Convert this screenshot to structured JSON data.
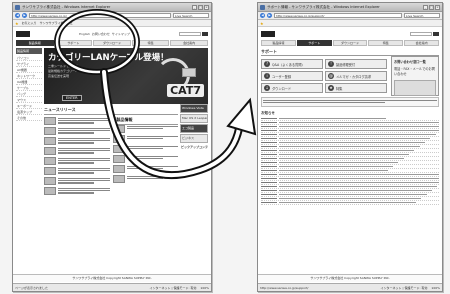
{
  "left_window": {
    "title": "サンワサプライ株式会社 - Windows Internet Explorer",
    "address": "http://www.sanwa.co.jp/",
    "search_placeholder": "Live Search",
    "favorites": [
      "お気に入り",
      "サンワサプライ株式会社"
    ],
    "header_links": [
      "English",
      "お問い合わせ",
      "サイトマップ"
    ],
    "menu": [
      "製品情報",
      "サポート",
      "ダウンロード",
      "特集",
      "会社案内"
    ],
    "nav_head": "製品情報",
    "nav_items": [
      "パソコン",
      "サプライ",
      "AV機器",
      "ネットワーク",
      "OA機器",
      "ケーブル",
      "バッグ",
      "マウス",
      "キーボード",
      "電源タップ",
      "その他"
    ],
    "banner_title": "カテゴリーLANケーブル登場！",
    "banner_lines": [
      "二重シールドで高品質",
      "最新規格カテゴリー7",
      "高速伝送を実現"
    ],
    "banner_enter": "ENTER",
    "banner_badge": "CAT7",
    "section_news": "ニュースリリース",
    "section_products": "新製品情報",
    "side_items": [
      "Windows Vista",
      "Mac OS X Leopard",
      "エコ製品",
      "ビジネス",
      "ピックアップコンテンツ"
    ],
    "footer": "サンワサプライ株式会社 Copyright SANWA SUPPLY INC.",
    "status_left": "ページが表示されました",
    "status_zone": "インターネット | 保護モード: 有効",
    "status_zoom": "100%"
  },
  "right_window": {
    "title": "サポート情報 - サンワサプライ株式会社 - Windows Internet Explorer",
    "address": "http://www.sanwa.co.jp/support/",
    "search_placeholder": "Live Search",
    "menu": [
      "製品情報",
      "サポート",
      "ダウンロード",
      "特集",
      "会社案内"
    ],
    "support_title": "サポート",
    "support_buttons": [
      {
        "icon": "?",
        "label": "Q&A（よくある質問）"
      },
      {
        "icon": "!",
        "label": "製品修理受付"
      },
      {
        "icon": "i",
        "label": "ユーザー登録"
      },
      {
        "icon": "@",
        "label": "メルマガ・カタログ請求"
      },
      {
        "icon": "↓",
        "label": "ダウンロード"
      },
      {
        "icon": "★",
        "label": "特集"
      }
    ],
    "side_title": "お問い合わせ窓口一覧",
    "side_text": "電話・FAX・メールでのお問い合わせ",
    "list_title": "お知らせ",
    "footer": "サンワサプライ株式会社 Copyright SANWA SUPPLY INC.",
    "status_left": "http://www.sanwa.co.jp/support/",
    "status_zone": "インターネット | 保護モード: 有効",
    "status_zoom": "100%"
  }
}
